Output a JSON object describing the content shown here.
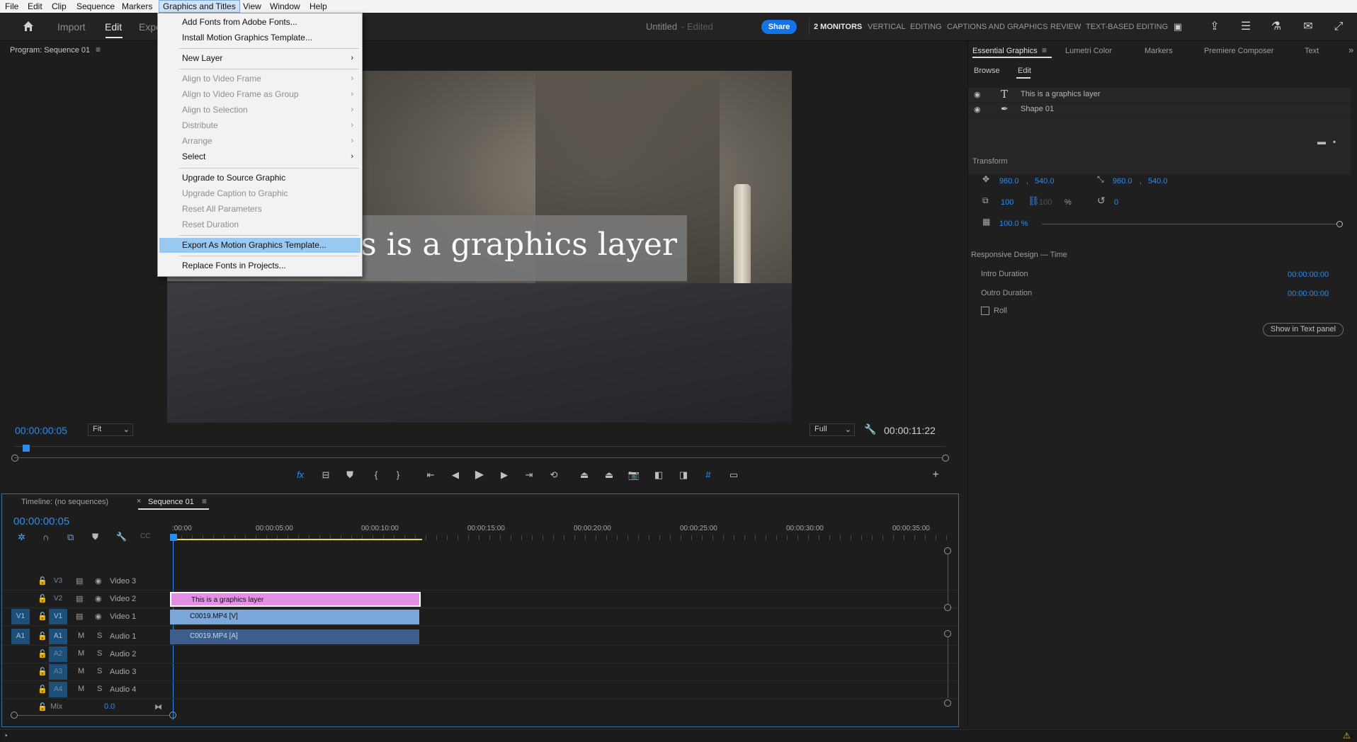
{
  "menubar": {
    "items": [
      "File",
      "Edit",
      "Clip",
      "Sequence",
      "Markers",
      "Graphics and Titles",
      "View",
      "Window",
      "Help"
    ],
    "active": "Graphics and Titles"
  },
  "header": {
    "tabs": [
      "Import",
      "Edit",
      "Expo"
    ],
    "active_tab": "Edit",
    "project_title": "Untitled",
    "project_state": "- Edited",
    "share_label": "Share",
    "workspaces": [
      "2 MONITORS",
      "VERTICAL",
      "EDITING",
      "CAPTIONS AND GRAPHICS",
      "REVIEW",
      "TEXT-BASED EDITING"
    ],
    "active_workspace": "2 MONITORS"
  },
  "graphics_menu": {
    "items": [
      {
        "label": "Add Fonts from Adobe Fonts...",
        "enabled": true,
        "submenu": false
      },
      {
        "label": "Install Motion Graphics Template...",
        "enabled": true,
        "submenu": false
      },
      {
        "label": "New Layer",
        "enabled": true,
        "submenu": true
      },
      {
        "label": "Align to Video Frame",
        "enabled": false,
        "submenu": true
      },
      {
        "label": "Align to Video Frame as Group",
        "enabled": false,
        "submenu": true
      },
      {
        "label": "Align to Selection",
        "enabled": false,
        "submenu": true
      },
      {
        "label": "Distribute",
        "enabled": false,
        "submenu": true
      },
      {
        "label": "Arrange",
        "enabled": false,
        "submenu": true
      },
      {
        "label": "Select",
        "enabled": true,
        "submenu": true
      },
      {
        "label": "Upgrade to Source Graphic",
        "enabled": true,
        "submenu": false
      },
      {
        "label": "Upgrade Caption to Graphic",
        "enabled": false,
        "submenu": false
      },
      {
        "label": "Reset All Parameters",
        "enabled": false,
        "submenu": false
      },
      {
        "label": "Reset Duration",
        "enabled": false,
        "submenu": false
      },
      {
        "label": "Export As Motion Graphics Template...",
        "enabled": true,
        "submenu": false,
        "highlighted": true
      },
      {
        "label": "Replace Fonts in Projects...",
        "enabled": true,
        "submenu": false
      }
    ]
  },
  "program_monitor": {
    "title": "Program: Sequence 01",
    "overlay_text": "is is a graphics layer",
    "current_timecode": "00:00:00:05",
    "fit_label": "Fit",
    "quality_label": "Full",
    "duration_timecode": "00:00:11:22"
  },
  "timeline": {
    "tab_no_seq": "Timeline: (no sequences)",
    "tab_seq": "Sequence 01",
    "timecode": "00:00:00:05",
    "ruler": [
      ":00:00",
      "00:00:05:00",
      "00:00:10:00",
      "00:00:15:00",
      "00:00:20:00",
      "00:00:25:00",
      "00:00:30:00",
      "00:00:35:00"
    ],
    "tracks": [
      {
        "id": "V3",
        "name": "Video 3",
        "type": "video",
        "src": ""
      },
      {
        "id": "V2",
        "name": "Video 2",
        "type": "video",
        "src": ""
      },
      {
        "id": "V1",
        "name": "Video 1",
        "type": "video",
        "src": "V1"
      },
      {
        "id": "A1",
        "name": "Audio 1",
        "type": "audio",
        "src": "A1"
      },
      {
        "id": "A2",
        "name": "Audio 2",
        "type": "audio",
        "src": ""
      },
      {
        "id": "A3",
        "name": "Audio 3",
        "type": "audio",
        "src": ""
      },
      {
        "id": "A4",
        "name": "Audio 4",
        "type": "audio",
        "src": ""
      }
    ],
    "mute_label": "M",
    "solo_label": "S",
    "mix_label": "Mix",
    "mix_value": "0.0",
    "clips": {
      "graphic": "This is a graphics layer",
      "video": "C0019.MP4 [V]",
      "audio": "C0019.MP4 [A]"
    }
  },
  "essential_graphics": {
    "tabs": [
      "Essential Graphics",
      "Lumetri Color",
      "Markers",
      "Premiere Composer",
      "Text"
    ],
    "subtabs": [
      "Browse",
      "Edit"
    ],
    "active_subtab": "Edit",
    "layers": [
      "This is a graphics layer",
      "Shape 01"
    ],
    "transform_label": "Transform",
    "position": [
      "960.0",
      "540.0"
    ],
    "anchor": [
      "960.0",
      "540.0"
    ],
    "scale": "100",
    "scale_linked": "100",
    "scale_unit": "%",
    "rotation": "0",
    "opacity": "100.0 %",
    "responsive_label": "Responsive Design — Time",
    "intro_label": "Intro Duration",
    "intro_value": "00:00:00:00",
    "outro_label": "Outro Duration",
    "outro_value": "00:00:00:00",
    "roll_label": "Roll",
    "show_text_panel": "Show in Text panel"
  },
  "colors": {
    "accent": "#2d8ceb",
    "graphic_clip": "#e38fe3",
    "video_clip": "#7ba7db",
    "audio_clip": "#3d5d8c"
  }
}
